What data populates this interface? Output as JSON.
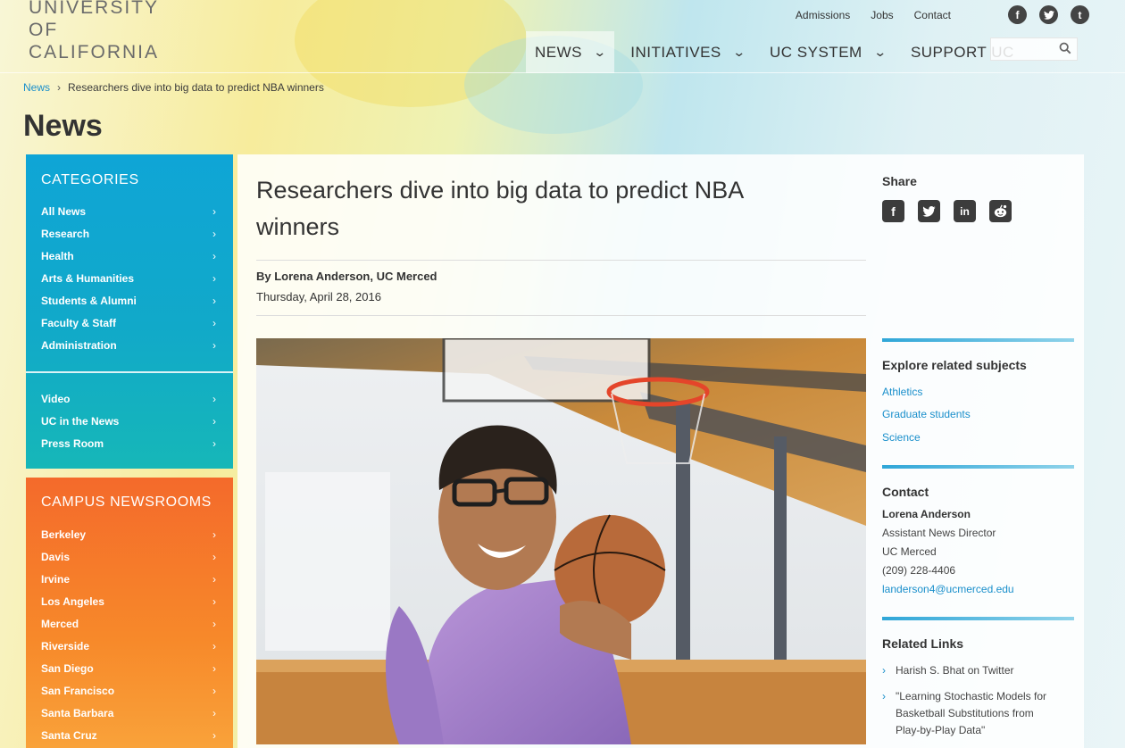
{
  "header": {
    "logo_lines": [
      "UNIVERSITY",
      "OF",
      "CALIFORNIA"
    ],
    "utility_links": [
      "Admissions",
      "Jobs",
      "Contact"
    ],
    "social_icons": [
      "facebook-icon",
      "twitter-icon",
      "tumblr-icon"
    ],
    "nav": [
      {
        "label": "NEWS",
        "has_dropdown": true,
        "active": true
      },
      {
        "label": "INITIATIVES",
        "has_dropdown": true
      },
      {
        "label": "UC SYSTEM",
        "has_dropdown": true
      },
      {
        "label": "SUPPORT UC",
        "has_dropdown": false
      }
    ],
    "search": {
      "value": "",
      "placeholder": ""
    }
  },
  "breadcrumb": {
    "root": "News",
    "current": "Researchers dive into big data to predict NBA winners"
  },
  "page_title": "News",
  "categories": {
    "heading": "CATEGORIES",
    "items": [
      "All News",
      "Research",
      "Health",
      "Arts & Humanities",
      "Students & Alumni",
      "Faculty & Staff",
      "Administration"
    ],
    "secondary": [
      "Video",
      "UC in the News",
      "Press Room"
    ]
  },
  "campus_newsrooms": {
    "heading": "CAMPUS NEWSROOMS",
    "items": [
      "Berkeley",
      "Davis",
      "Irvine",
      "Los Angeles",
      "Merced",
      "Riverside",
      "San Diego",
      "San Francisco",
      "Santa Barbara",
      "Santa Cruz"
    ]
  },
  "article": {
    "title": "Researchers dive into big data to predict NBA winners",
    "byline": "By Lorena Anderson, UC Merced",
    "date": "Thursday, April 28, 2016"
  },
  "share": {
    "heading": "Share",
    "icons": [
      "facebook-icon",
      "twitter-icon",
      "linkedin-icon",
      "reddit-icon"
    ]
  },
  "explore": {
    "heading": "Explore related subjects",
    "links": [
      "Athletics",
      "Graduate students",
      "Science"
    ]
  },
  "contact": {
    "heading": "Contact",
    "name": "Lorena Anderson",
    "title": "Assistant News Director",
    "org": "UC Merced",
    "phone": "(209) 228-4406",
    "email": "landerson4@ucmerced.edu"
  },
  "related_links": {
    "heading": "Related Links",
    "items": [
      "Harish S. Bhat on Twitter",
      "\"Learning Stochastic Models for Basketball Substitutions from Play-by-Play Data\""
    ]
  },
  "colors": {
    "link": "#1a8fcb",
    "categories_bg": "#0fa5d6",
    "campus_bg": "#f46a2b",
    "rule": "#2fa6d8"
  }
}
